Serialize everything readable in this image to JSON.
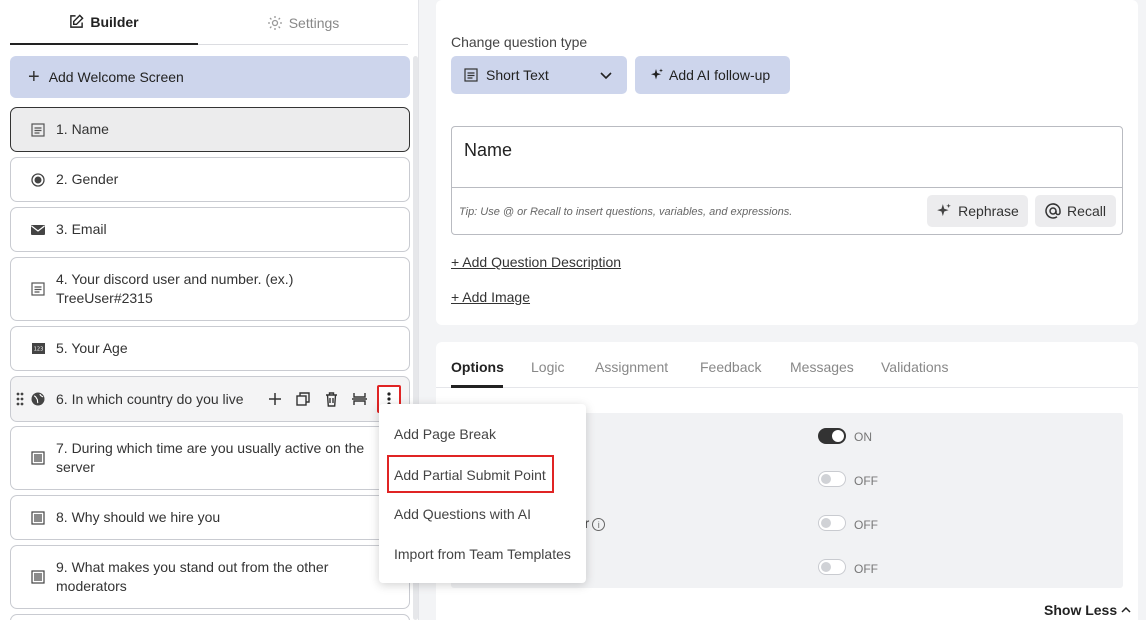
{
  "sidebar": {
    "tabs": {
      "builder": "Builder",
      "settings": "Settings"
    },
    "welcome_label": "Add Welcome Screen",
    "questions": [
      {
        "label": "1. Name",
        "icon": "short-text-icon"
      },
      {
        "label": "2. Gender",
        "icon": "radio-icon"
      },
      {
        "label": "3. Email",
        "icon": "envelope-icon"
      },
      {
        "label": "4. Your discord user and number. (ex.)",
        "label2": "TreeUser#2315",
        "icon": "short-text-icon"
      },
      {
        "label": "5. Your Age",
        "icon": "number-icon"
      },
      {
        "label": "6. In which country do you live",
        "icon": "globe-icon"
      },
      {
        "label": "7. During which time are you usually active on the",
        "label2": "server",
        "icon": "long-text-icon"
      },
      {
        "label": "8. Why should we hire you",
        "icon": "long-text-icon"
      },
      {
        "label": "9. What makes you stand out from the other",
        "label2": "moderators",
        "icon": "long-text-icon"
      }
    ]
  },
  "menu": {
    "items": [
      "Add Page Break",
      "Add Partial Submit Point",
      "Add Questions with AI",
      "Import from Team Templates"
    ]
  },
  "editor": {
    "change_type_label": "Change question type",
    "type_value": "Short Text",
    "ai_followup": "Add AI follow-up",
    "question_title": "Name",
    "tip": "Tip: Use @ or Recall to insert questions, variables, and expressions.",
    "rephrase": "Rephrase",
    "recall": "Recall",
    "add_description": "+ Add Question Description",
    "add_image": "+ Add Image"
  },
  "options": {
    "tabs": [
      "Options",
      "Logic",
      "Assignment",
      "Feedback",
      "Messages",
      "Validations"
    ],
    "partial_label": "ber",
    "toggles": [
      {
        "state": "ON"
      },
      {
        "state": "OFF"
      },
      {
        "state": "OFF"
      },
      {
        "state": "OFF"
      }
    ],
    "show_less": "Show Less"
  },
  "colors": {
    "accent_bg": "#cdd5ec",
    "highlight": "#e02424"
  }
}
